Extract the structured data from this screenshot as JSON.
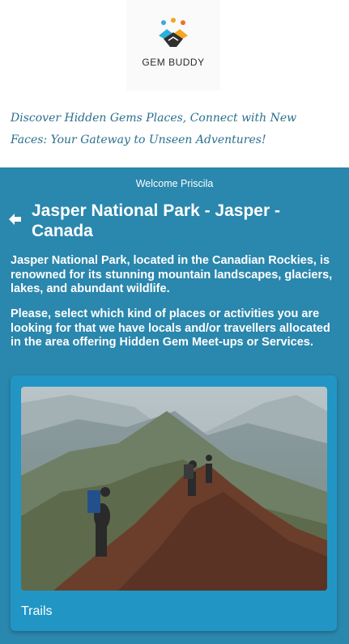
{
  "brand": {
    "name": "GEM BUDDY"
  },
  "tagline": "Discover Hidden Gems Places, Connect with New Faces: Your Gateway to Unseen Adventures!",
  "welcome": "Welcome Priscila",
  "location": {
    "title": "Jasper National Park - Jasper - Canada",
    "description": "Jasper National Park, located in the Canadian Rockies, is renowned for its stunning mountain landscapes, glaciers, lakes, and abundant wildlife.",
    "instructions": "Please, select which kind of places or activities you are looking for that we have locals and/or travellers allocated in the area offering Hidden Gem Meet-ups or Services."
  },
  "categories": [
    {
      "label": "Trails",
      "image": "hikers-mountain-trail"
    }
  ],
  "icons": {
    "back": "back-arrow-icon",
    "logo": "handshake-icon"
  },
  "colors": {
    "primary": "#2a87ad",
    "card": "#2196c4",
    "tagline": "#2a6f8e"
  }
}
